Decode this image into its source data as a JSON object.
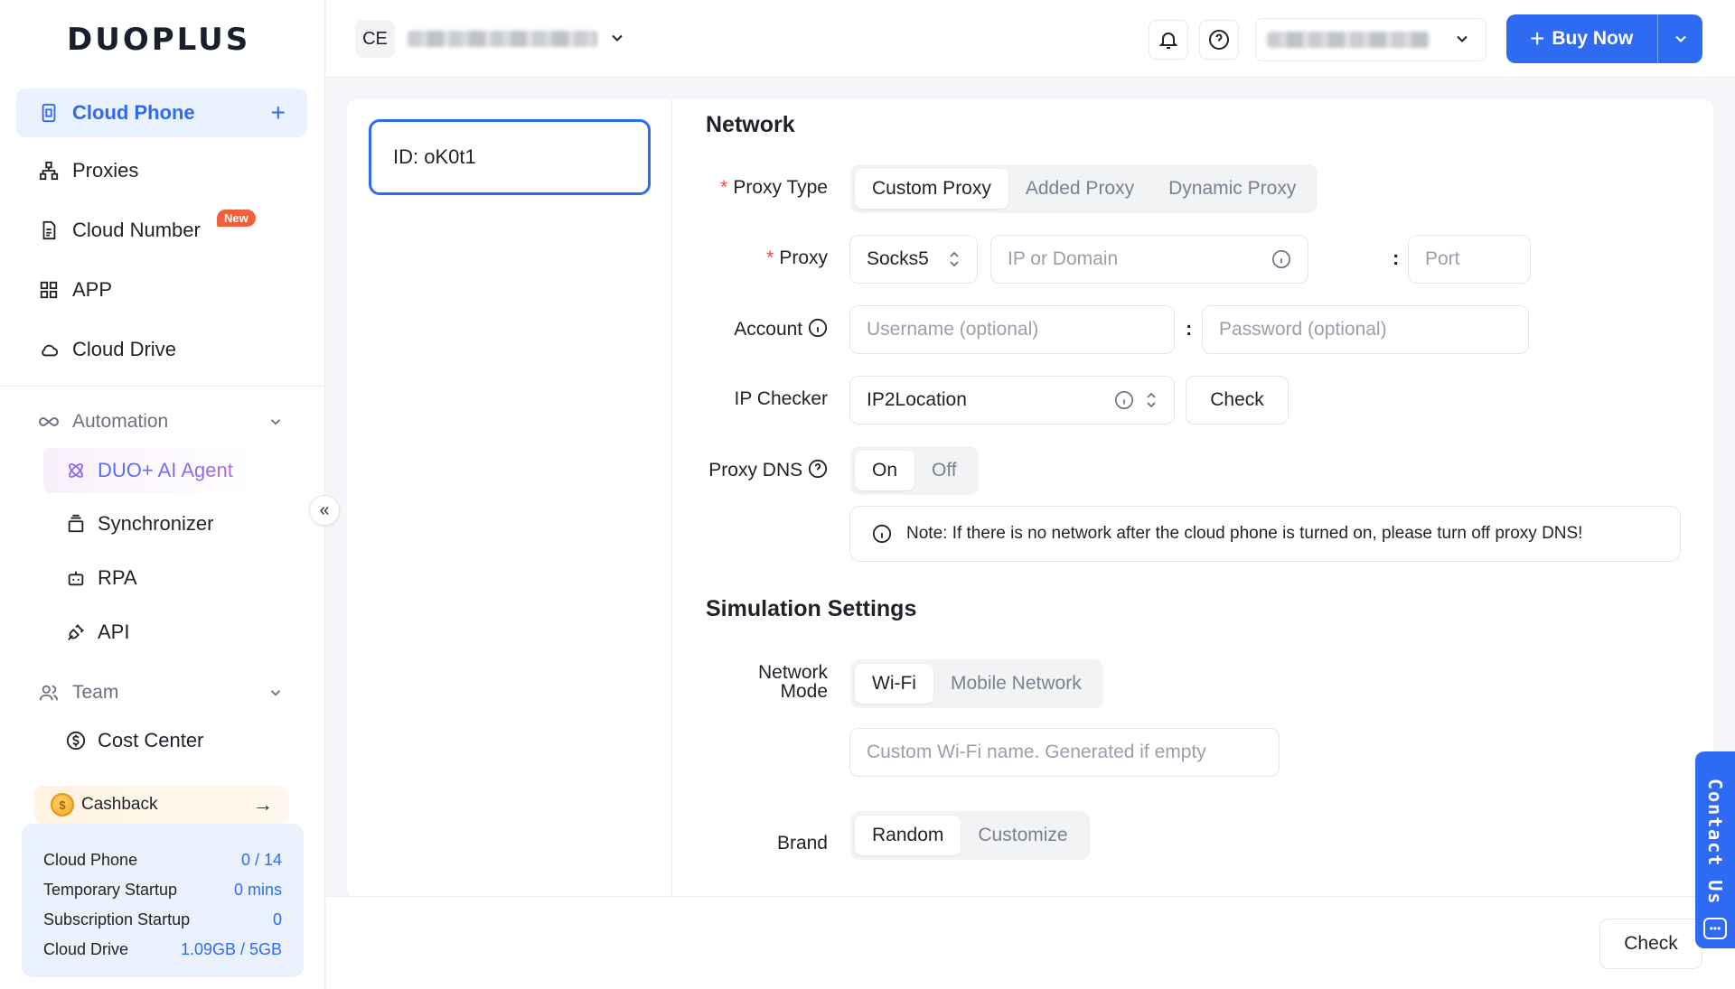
{
  "sidebar": {
    "logo": "DUOPLUS",
    "items": [
      {
        "label": "Cloud Phone",
        "icon": "phone-icon"
      },
      {
        "label": "Proxies",
        "icon": "network-icon"
      },
      {
        "label": "Cloud Number",
        "icon": "sim-icon",
        "badge": "New"
      },
      {
        "label": "APP",
        "icon": "grid-icon"
      },
      {
        "label": "Cloud Drive",
        "icon": "cloud-icon"
      }
    ],
    "automation": {
      "label": "Automation",
      "items": [
        "DUO+ AI Agent",
        "Synchronizer",
        "RPA",
        "API"
      ]
    },
    "team": {
      "label": "Team",
      "items": [
        "Cost Center"
      ]
    },
    "cashback": "Cashback",
    "usage": [
      {
        "label": "Cloud Phone",
        "value": "0 / 14"
      },
      {
        "label": "Temporary Startup",
        "value": "0 mins"
      },
      {
        "label": "Subscription Startup",
        "value": "0"
      },
      {
        "label": "Cloud Drive",
        "value": "1.09GB / 5GB"
      }
    ]
  },
  "header": {
    "org_initials": "CE",
    "buy_label": "Buy Now"
  },
  "device": {
    "id_label": "ID: oK0t1"
  },
  "network": {
    "title": "Network",
    "proxy_type_label": "Proxy Type",
    "proxy_type_options": [
      "Custom Proxy",
      "Added Proxy",
      "Dynamic Proxy"
    ],
    "proxy_label": "Proxy",
    "proxy_protocol": "Socks5",
    "host_placeholder": "IP or Domain",
    "port_placeholder": "Port",
    "account_label": "Account",
    "username_placeholder": "Username (optional)",
    "password_placeholder": "Password (optional)",
    "ip_checker_label": "IP Checker",
    "ip_checker_value": "IP2Location",
    "check_label": "Check",
    "proxy_dns_label": "Proxy DNS",
    "proxy_dns_options": [
      "On",
      "Off"
    ],
    "note": "Note: If there is no network after the cloud phone is turned on, please turn off proxy DNS!"
  },
  "simulation": {
    "title": "Simulation Settings",
    "network_mode_label_1": "Network",
    "network_mode_label_2": "Mode",
    "network_mode_options": [
      "Wi-Fi",
      "Mobile Network"
    ],
    "wifi_placeholder": "Custom Wi-Fi name. Generated if empty",
    "brand_label": "Brand",
    "brand_options": [
      "Random",
      "Customize"
    ]
  },
  "footer": {
    "check_label": "Check"
  },
  "contact": {
    "label": "Contact Us"
  },
  "colors": {
    "accent": "#2f6bf2",
    "badge": "#f25f3a"
  }
}
